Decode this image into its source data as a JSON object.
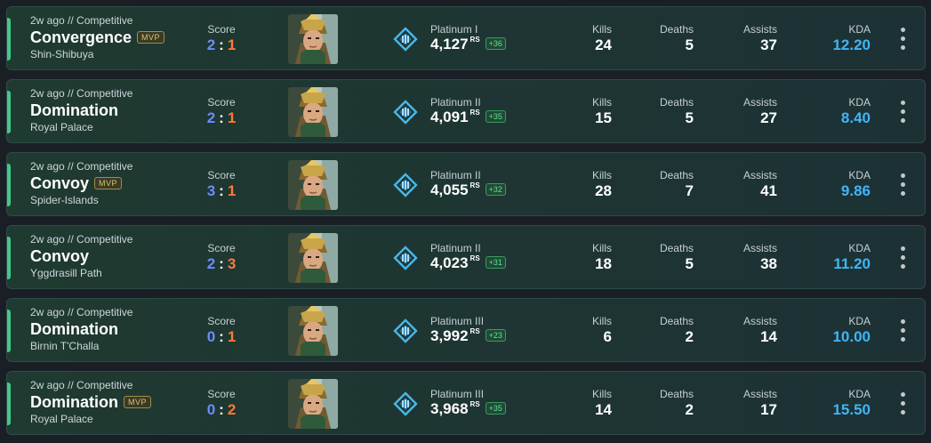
{
  "labels": {
    "score": "Score",
    "kills": "Kills",
    "deaths": "Deaths",
    "assists": "Assists",
    "kda": "KDA",
    "rs_unit": "RS",
    "mvp": "MVP",
    "separator": ":"
  },
  "matches": [
    {
      "time": "2w ago",
      "queue": "Competitive",
      "mode": "Convergence",
      "mvp": true,
      "map": "Shin-Shibuya",
      "score_a": "2",
      "score_b": "1",
      "hero_icon": "hero-portrait-icon",
      "rank": "Platinum I",
      "rs": "4,127",
      "rs_delta": "+36",
      "kills": "24",
      "deaths": "5",
      "assists": "37",
      "kda": "12.20"
    },
    {
      "time": "2w ago",
      "queue": "Competitive",
      "mode": "Domination",
      "mvp": false,
      "map": "Royal Palace",
      "score_a": "2",
      "score_b": "1",
      "hero_icon": "hero-portrait-icon",
      "rank": "Platinum II",
      "rs": "4,091",
      "rs_delta": "+35",
      "kills": "15",
      "deaths": "5",
      "assists": "27",
      "kda": "8.40"
    },
    {
      "time": "2w ago",
      "queue": "Competitive",
      "mode": "Convoy",
      "mvp": true,
      "map": "Spider-Islands",
      "score_a": "3",
      "score_b": "1",
      "hero_icon": "hero-portrait-icon",
      "rank": "Platinum II",
      "rs": "4,055",
      "rs_delta": "+32",
      "kills": "28",
      "deaths": "7",
      "assists": "41",
      "kda": "9.86"
    },
    {
      "time": "2w ago",
      "queue": "Competitive",
      "mode": "Convoy",
      "mvp": false,
      "map": "Yggdrasill Path",
      "score_a": "2",
      "score_b": "3",
      "hero_icon": "hero-portrait-icon",
      "rank": "Platinum II",
      "rs": "4,023",
      "rs_delta": "+31",
      "kills": "18",
      "deaths": "5",
      "assists": "38",
      "kda": "11.20"
    },
    {
      "time": "2w ago",
      "queue": "Competitive",
      "mode": "Domination",
      "mvp": false,
      "map": "Birnin T'Challa",
      "score_a": "0",
      "score_b": "1",
      "hero_icon": "hero-portrait-icon",
      "rank": "Platinum III",
      "rs": "3,992",
      "rs_delta": "+23",
      "kills": "6",
      "deaths": "2",
      "assists": "14",
      "kda": "10.00"
    },
    {
      "time": "2w ago",
      "queue": "Competitive",
      "mode": "Domination",
      "mvp": true,
      "map": "Royal Palace",
      "score_a": "0",
      "score_b": "2",
      "hero_icon": "hero-portrait-icon",
      "rank": "Platinum III",
      "rs": "3,968",
      "rs_delta": "+35",
      "kills": "14",
      "deaths": "2",
      "assists": "17",
      "kda": "15.50"
    }
  ],
  "colors": {
    "win_stripe": "#41c98b",
    "score_team_a": "#6d8cff",
    "score_team_b": "#ff7a35",
    "kda": "#3fb6f6",
    "rs_delta": "#5fe09a",
    "mvp_badge": "#d8c56a"
  },
  "icons": {
    "rank": "platinum-rank-icon",
    "menu": "more-vertical-icon"
  }
}
